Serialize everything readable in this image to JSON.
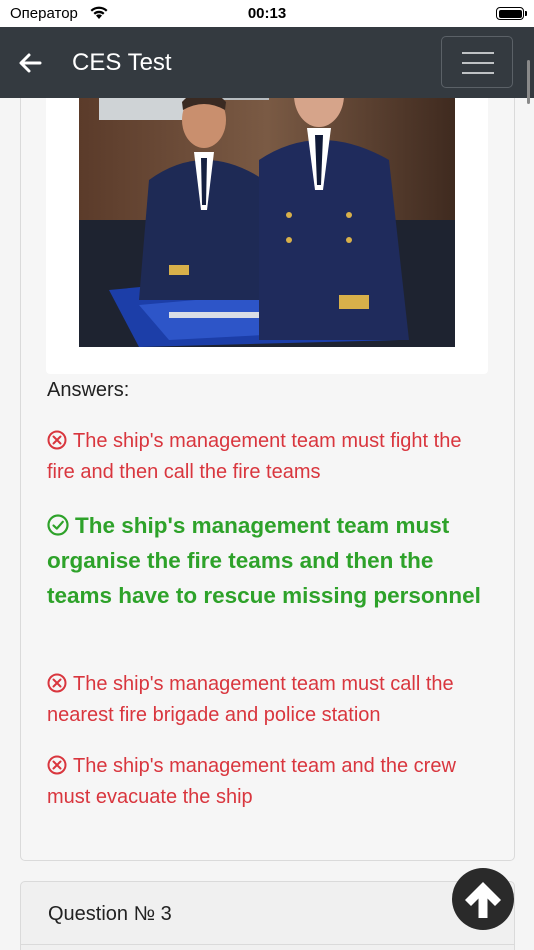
{
  "status_bar": {
    "carrier": "Оператор",
    "time": "00:13"
  },
  "navbar": {
    "title": "CES Test",
    "back_icon": "arrow-left-icon",
    "menu_icon": "hamburger-menu-icon"
  },
  "question": {
    "image_description_icon": "photo",
    "answers_heading": "Answers:",
    "answers": [
      {
        "text": "The ship's management team must fight the fire and then call the fire teams",
        "correct": false,
        "icon": "x-circle-icon"
      },
      {
        "text": "The ship's management team must organise the fire teams and then the teams have to rescue missing personnel",
        "correct": true,
        "icon": "check-circle-icon"
      },
      {
        "text": "The ship's management team must call the nearest fire brigade and police station",
        "correct": false,
        "icon": "x-circle-icon"
      },
      {
        "text": "The ship's management team and the crew must evacuate the ship",
        "correct": false,
        "icon": "x-circle-icon"
      }
    ]
  },
  "next_question": {
    "title": "Question № 3"
  },
  "colors": {
    "navbar": "#343a40",
    "wrong": "#d9363e",
    "correct": "#2ea22a"
  },
  "scroll_top_icon": "arrow-up-icon"
}
